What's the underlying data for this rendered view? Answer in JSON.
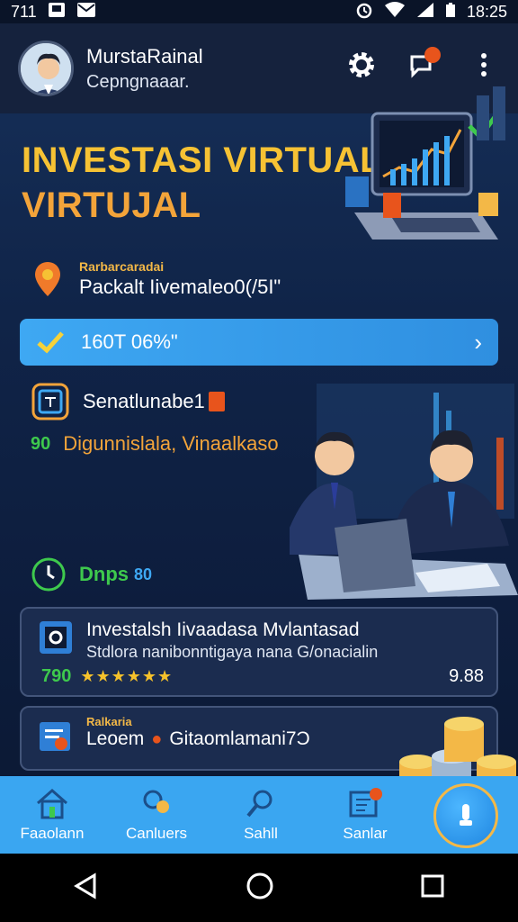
{
  "status_bar": {
    "time_left": "711",
    "time_right": "18:25"
  },
  "header": {
    "user_name": "MurstaRainal",
    "user_sub": "Cepngnaaar."
  },
  "hero": {
    "line1": "INVESTASI VIRTUAL",
    "line2": "VIRTUJAL"
  },
  "info": {
    "small": "Rarbarcaradai",
    "big": "Packalt Iivemaleo0(/5I\""
  },
  "cta": {
    "label": "160T 06%\""
  },
  "rows": [
    {
      "label": "Senatlunabe1"
    },
    {
      "prefix": "90",
      "label": "Digunnislala, Vinaalkaso"
    },
    {
      "label": "Dnps",
      "suffix": "80"
    }
  ],
  "card1": {
    "title": "Investalsh Iivaadasa Mvlantasad",
    "sub": "Stdlora nanibonntigaya nana G/onacialin",
    "left_value": "790",
    "stars": "★★★★★★",
    "right_value": "9.88"
  },
  "card2": {
    "small": "Ralkaria",
    "title": "Leoem",
    "title2": "Gitaomlamani7Ɔ"
  },
  "nav": {
    "items": [
      "Faaolann",
      "Canluers",
      "Sahll",
      "Sanlar"
    ]
  },
  "colors": {
    "accent_blue": "#3aa6f1",
    "gold": "#f6c234",
    "orange": "#f3a43a"
  }
}
